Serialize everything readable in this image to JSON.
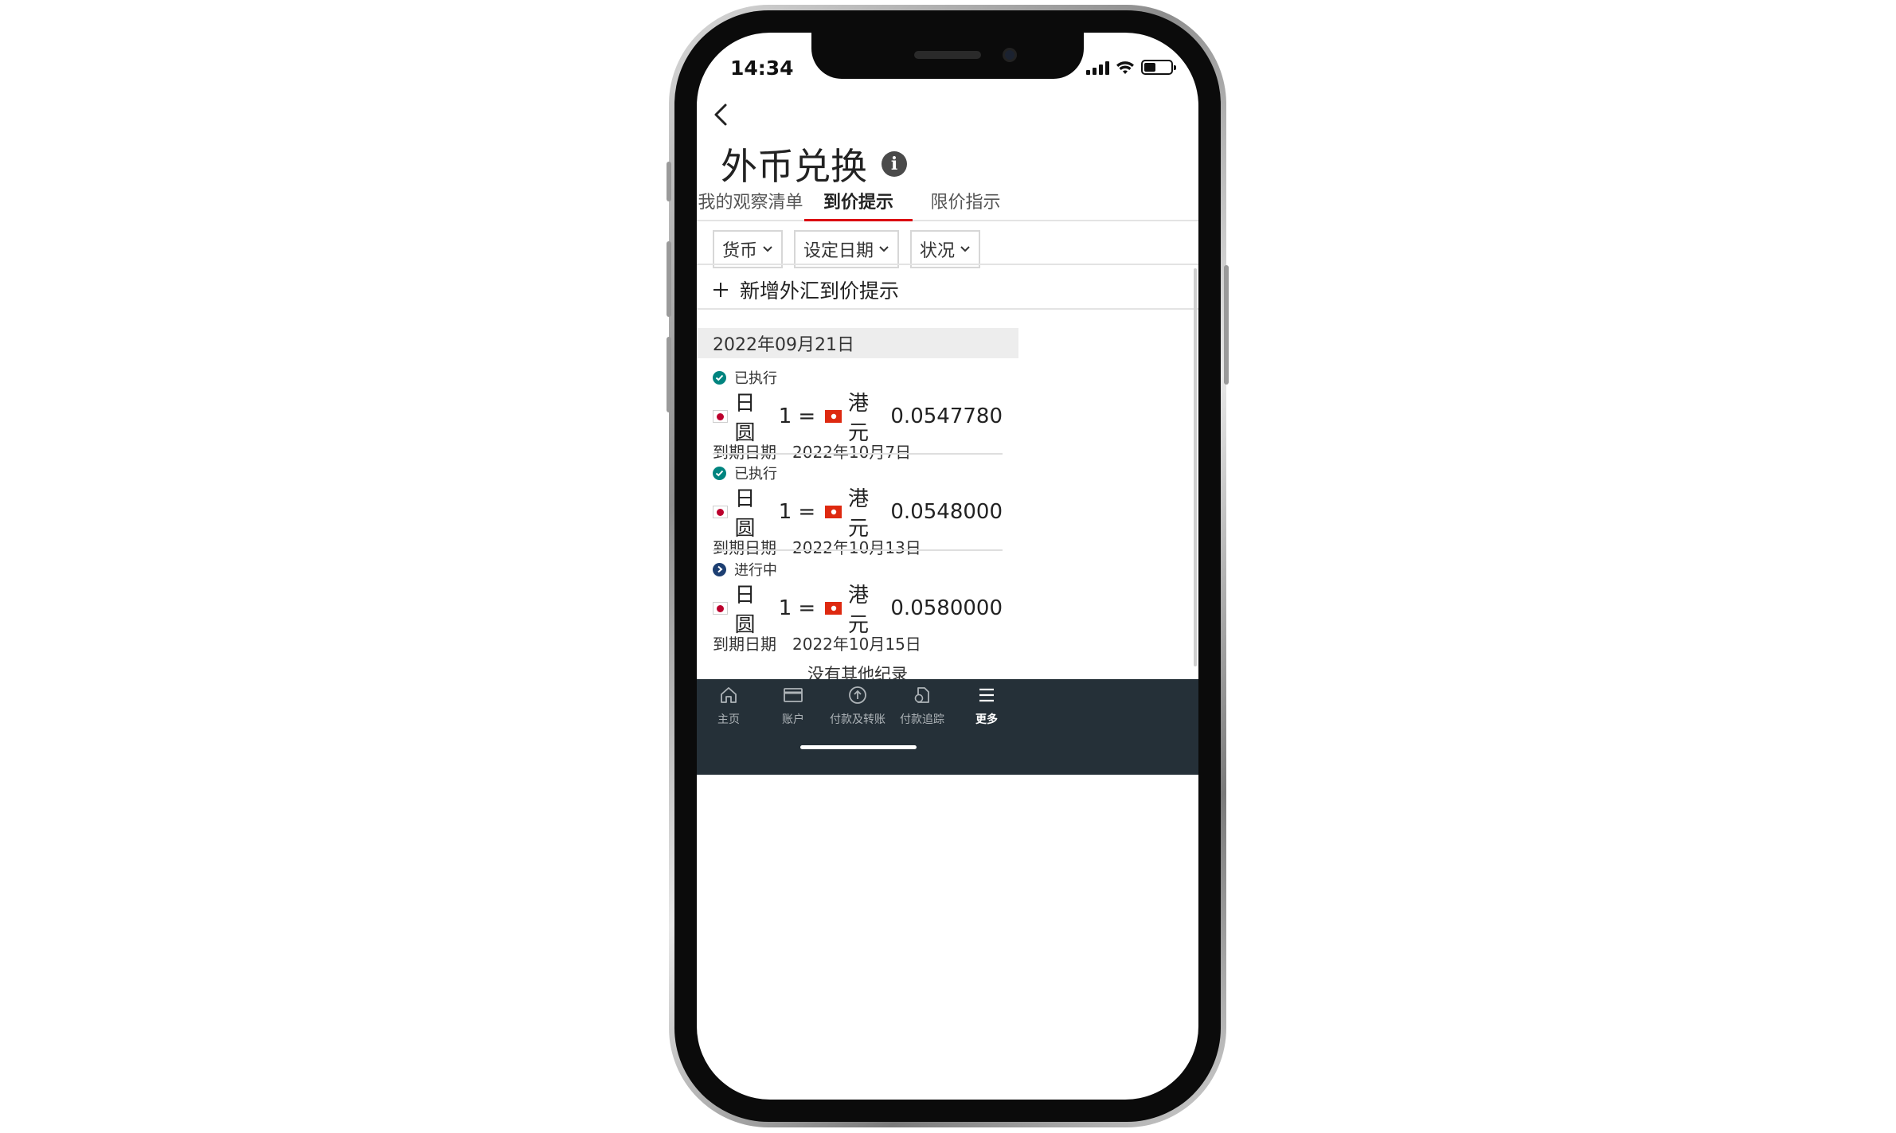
{
  "status_bar": {
    "time": "14:34"
  },
  "header": {
    "title": "外币兑换",
    "info_glyph": "i"
  },
  "tabs": [
    {
      "label": "我的观察清单"
    },
    {
      "label": "到价提示"
    },
    {
      "label": "限价指示"
    }
  ],
  "filters": {
    "currency": "货币",
    "set_date": "设定日期",
    "status": "状况"
  },
  "add_alert_label": "新增外汇到价提示",
  "date_group": "2022年09月21日",
  "records": [
    {
      "status": "已执行",
      "from_currency": "日圆",
      "from_amount": "1",
      "equals": "=",
      "to_currency": "港元",
      "to_rate": "0.0547780",
      "expiry_label": "到期日期",
      "expiry_date": "2022年10月7日"
    },
    {
      "status": "已执行",
      "from_currency": "日圆",
      "from_amount": "1",
      "equals": "=",
      "to_currency": "港元",
      "to_rate": "0.0548000",
      "expiry_label": "到期日期",
      "expiry_date": "2022年10月13日"
    },
    {
      "status": "进行中",
      "from_currency": "日圆",
      "from_amount": "1",
      "equals": "=",
      "to_currency": "港元",
      "to_rate": "0.0580000",
      "expiry_label": "到期日期",
      "expiry_date": "2022年10月15日"
    }
  ],
  "no_more_records": "没有其他纪录",
  "bottom_nav": [
    {
      "label": "主页",
      "icon": "home-icon"
    },
    {
      "label": "账户",
      "icon": "card-icon"
    },
    {
      "label": "付款及转账",
      "icon": "upload-circle-icon"
    },
    {
      "label": "付款追踪",
      "icon": "document-tracking-icon"
    },
    {
      "label": "更多",
      "icon": "menu-icon"
    }
  ],
  "colors": {
    "accent_red": "#db0011",
    "executed_green": "#00847f",
    "in_progress_blue": "#1d3f72",
    "nav_background": "#253038"
  }
}
